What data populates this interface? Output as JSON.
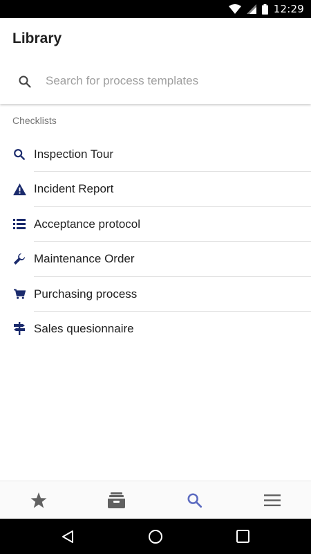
{
  "status_bar": {
    "time": "12:29",
    "icons": [
      "wifi-icon",
      "cell-signal-icon",
      "battery-icon"
    ]
  },
  "app_bar": {
    "title": "Library"
  },
  "search": {
    "placeholder": "Search for process templates",
    "value": "",
    "icon": "search-icon"
  },
  "section": {
    "header": "Checklists"
  },
  "items": [
    {
      "label": "Inspection Tour",
      "icon": "search-icon"
    },
    {
      "label": "Incident Report",
      "icon": "warning-icon"
    },
    {
      "label": "Acceptance protocol",
      "icon": "list-icon"
    },
    {
      "label": "Maintenance Order",
      "icon": "wrench-icon"
    },
    {
      "label": "Purchasing process",
      "icon": "cart-icon"
    },
    {
      "label": "Sales quesionnaire",
      "icon": "signpost-icon"
    }
  ],
  "bottom_nav": {
    "tabs": [
      {
        "icon": "star-icon",
        "active": false
      },
      {
        "icon": "inbox-icon",
        "active": false
      },
      {
        "icon": "search-icon",
        "active": true
      },
      {
        "icon": "menu-icon",
        "active": false
      }
    ]
  },
  "system_nav": [
    "back-icon",
    "home-icon",
    "recents-icon"
  ],
  "colors": {
    "accent": "#1a2a6c",
    "nav_inactive": "#616161",
    "nav_active": "#5c6bc0",
    "divider": "#e0e0e0",
    "placeholder": "#9e9e9e"
  }
}
